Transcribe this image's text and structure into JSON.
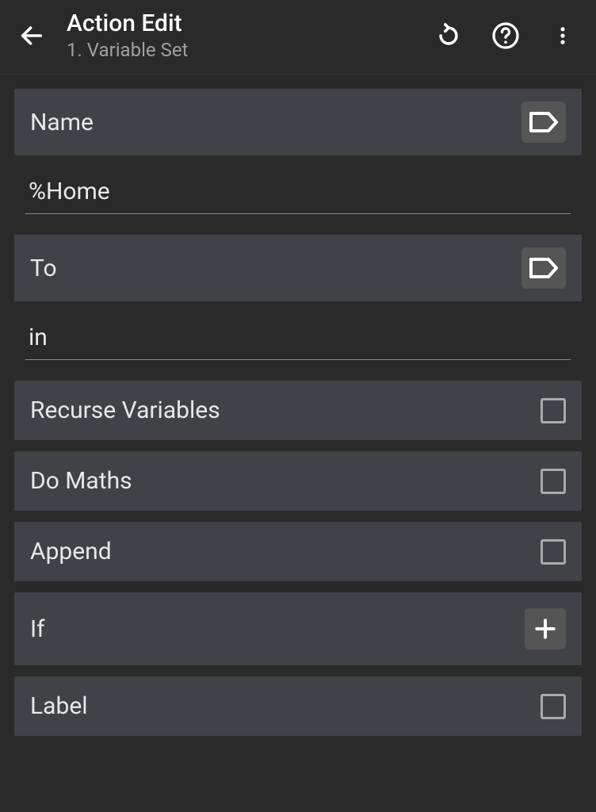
{
  "header": {
    "title": "Action Edit",
    "subtitle": "1. Variable Set"
  },
  "fields": {
    "name": {
      "label": "Name",
      "value": "%Home"
    },
    "to": {
      "label": "To",
      "value": "in"
    }
  },
  "options": {
    "recurse": {
      "label": "Recurse Variables",
      "checked": false
    },
    "maths": {
      "label": "Do Maths",
      "checked": false
    },
    "append": {
      "label": "Append",
      "checked": false
    },
    "if": {
      "label": "If"
    },
    "label": {
      "label": "Label",
      "checked": false
    }
  }
}
